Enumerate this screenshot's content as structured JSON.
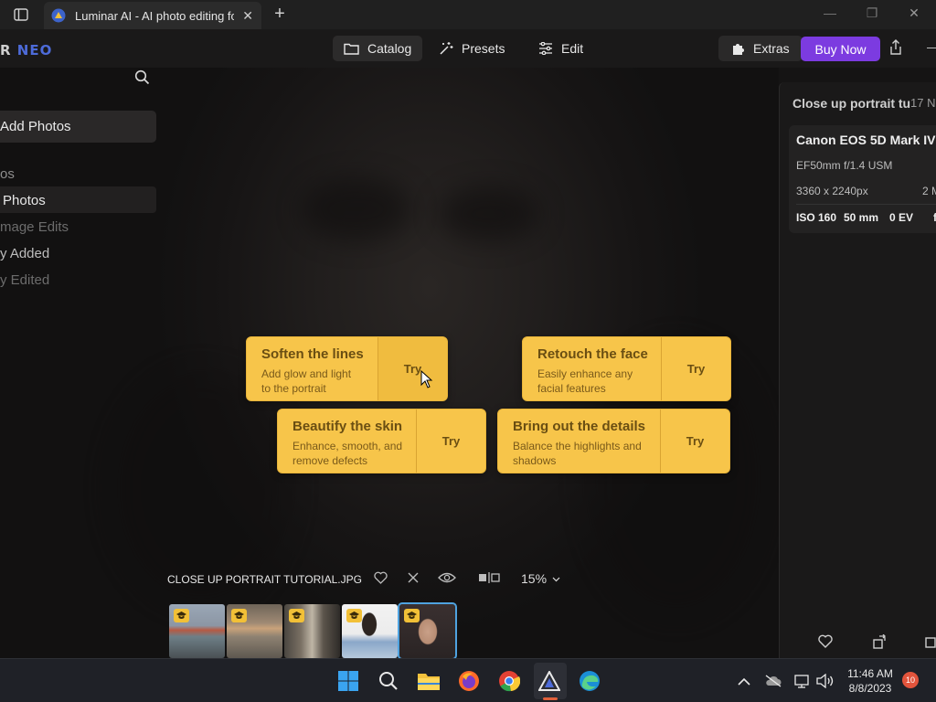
{
  "browser": {
    "tab_title": "Luminar AI - AI photo editing for",
    "close_icon": "close-icon",
    "new_tab_icon": "plus-icon"
  },
  "app": {
    "logo_left": "R",
    "logo_right": "NEO",
    "nav": {
      "catalog": "Catalog",
      "presets": "Presets",
      "edit": "Edit"
    },
    "extras": "Extras",
    "buy_now": "Buy Now"
  },
  "sidebar": {
    "add_photos": "Add Photos",
    "items": [
      "os",
      "Photos",
      "mage Edits",
      "y Added",
      "y Edited"
    ]
  },
  "cards": [
    {
      "title": "Soften the lines",
      "desc1": "Add glow and light",
      "desc2": "to the portrait",
      "action": "Try"
    },
    {
      "title": "Retouch the face",
      "desc1": "Easily enhance any",
      "desc2": "facial features",
      "action": "Try"
    },
    {
      "title": "Beautify the skin",
      "desc1": "Enhance, smooth, and",
      "desc2": "remove defects",
      "action": "Try"
    },
    {
      "title": "Bring out the details",
      "desc1": "Balance the highlights and",
      "desc2": "shadows",
      "action": "Try"
    }
  ],
  "filebar": {
    "filename": "CLOSE UP PORTRAIT TUTORIAL.JPG",
    "zoom": "15%"
  },
  "info_panel": {
    "title": "Close up portrait tu",
    "date": "17 No",
    "camera": "Canon EOS 5D Mark IV",
    "lens": "EF50mm f/1.4 USM",
    "resolution": "3360 x 2240px",
    "megapixels": "2 M",
    "iso": "ISO 160",
    "focal": "50 mm",
    "ev": "0 EV",
    "extra": "f"
  },
  "taskbar": {
    "time": "11:46 AM",
    "date": "8/8/2023",
    "notifications": "10"
  },
  "colors": {
    "accent_purple": "#7c3be0",
    "card_yellow": "#f7c54a",
    "selection_blue": "#4fa3e0"
  }
}
